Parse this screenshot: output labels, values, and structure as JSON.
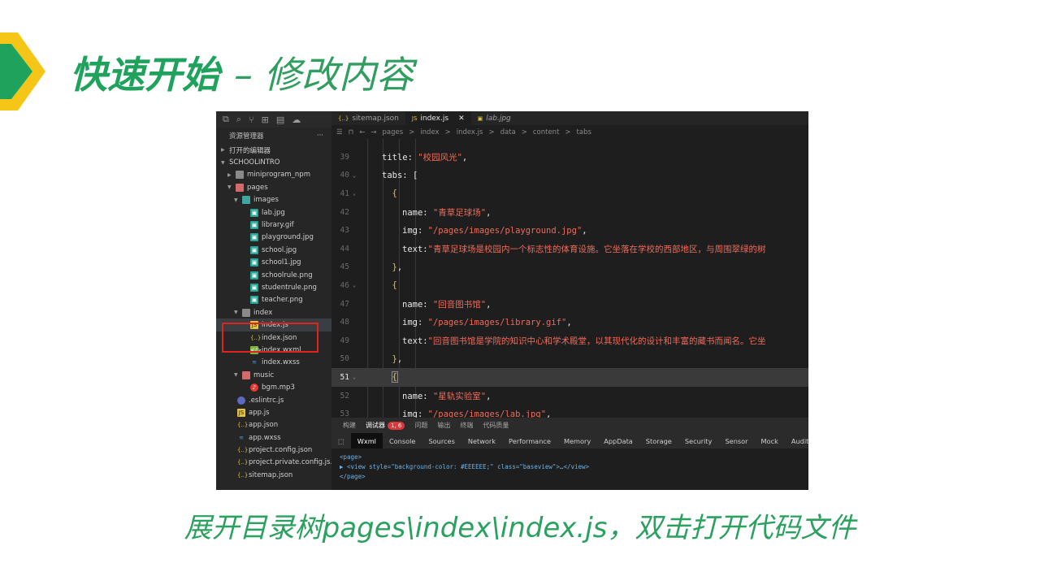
{
  "slide": {
    "title_main": "快速开始",
    "title_sep": "–",
    "title_sub": "修改内容",
    "caption": "展开目录树pages\\index\\index.js，双击打开代码文件",
    "accent_green": "#1fa35c",
    "accent_yellow": "#f5c518",
    "highlight_red": "#e0231c"
  },
  "ide": {
    "explorer_title": "资源管理器",
    "explorer_more": "···",
    "open_editors": "打开的编辑器",
    "project": "SCHOOLINTRO",
    "tree": [
      {
        "label": "miniprogram_npm",
        "depth": 1,
        "type": "folder",
        "twisty": "▶"
      },
      {
        "label": "pages",
        "depth": 1,
        "type": "fpink",
        "twisty": "▼"
      },
      {
        "label": "images",
        "depth": 2,
        "type": "fimg",
        "twisty": "▼"
      },
      {
        "label": "lab.jpg",
        "depth": 3,
        "type": "img"
      },
      {
        "label": "library.gif",
        "depth": 3,
        "type": "img"
      },
      {
        "label": "playground.jpg",
        "depth": 3,
        "type": "img"
      },
      {
        "label": "school.jpg",
        "depth": 3,
        "type": "img"
      },
      {
        "label": "school1.jpg",
        "depth": 3,
        "type": "img"
      },
      {
        "label": "schoolrule.png",
        "depth": 3,
        "type": "img"
      },
      {
        "label": "studentrule.png",
        "depth": 3,
        "type": "img"
      },
      {
        "label": "teacher.png",
        "depth": 3,
        "type": "img"
      },
      {
        "label": "index",
        "depth": 2,
        "type": "folder",
        "twisty": "▼"
      },
      {
        "label": "index.js",
        "depth": 3,
        "type": "js",
        "selected": true
      },
      {
        "label": "index.json",
        "depth": 3,
        "type": "json"
      },
      {
        "label": "index.wxml",
        "depth": 3,
        "type": "wxml"
      },
      {
        "label": "index.wxss",
        "depth": 3,
        "type": "css"
      },
      {
        "label": "music",
        "depth": 2,
        "type": "fpink",
        "twisty": "▼"
      },
      {
        "label": "bgm.mp3",
        "depth": 3,
        "type": "mp3"
      },
      {
        "label": ".eslintrc.js",
        "depth": 1,
        "type": "eslint"
      },
      {
        "label": "app.js",
        "depth": 1,
        "type": "js"
      },
      {
        "label": "app.json",
        "depth": 1,
        "type": "json"
      },
      {
        "label": "app.wxss",
        "depth": 1,
        "type": "css"
      },
      {
        "label": "project.config.json",
        "depth": 1,
        "type": "json"
      },
      {
        "label": "project.private.config.js...",
        "depth": 1,
        "type": "json"
      },
      {
        "label": "sitemap.json",
        "depth": 1,
        "type": "json"
      }
    ],
    "tabs": [
      {
        "label": "sitemap.json",
        "icon": "{..}"
      },
      {
        "label": "index.js",
        "icon": "JS",
        "active": true,
        "close": "✕"
      },
      {
        "label": "lab.jpg",
        "icon": "▣",
        "italic": true
      }
    ],
    "breadcrumb": [
      "pages",
      "index",
      "index.js",
      "data",
      "content",
      "tabs"
    ],
    "code_lines": [
      {
        "n": "39",
        "indent": 2,
        "parts": [
          [
            "k",
            "title"
          ],
          [
            "p",
            ": "
          ],
          [
            "s",
            "\"校园风光\""
          ],
          [
            "p",
            ","
          ]
        ]
      },
      {
        "n": "40",
        "indent": 2,
        "fold": true,
        "parts": [
          [
            "k",
            "tabs"
          ],
          [
            "p",
            ": ["
          ]
        ]
      },
      {
        "n": "41",
        "indent": 3,
        "fold": true,
        "parts": [
          [
            "br",
            "{"
          ]
        ]
      },
      {
        "n": "42",
        "indent": 4,
        "parts": [
          [
            "k",
            "name"
          ],
          [
            "p",
            ": "
          ],
          [
            "s",
            "\"青草足球场\""
          ],
          [
            "p",
            ","
          ]
        ]
      },
      {
        "n": "43",
        "indent": 4,
        "parts": [
          [
            "k",
            "img"
          ],
          [
            "p",
            ": "
          ],
          [
            "s",
            "\"/pages/images/playground.jpg\""
          ],
          [
            "p",
            ","
          ]
        ]
      },
      {
        "n": "44",
        "indent": 4,
        "parts": [
          [
            "k",
            "text"
          ],
          [
            "p",
            ":"
          ],
          [
            "s",
            "\"青草足球场是校园内一个标志性的体育设施。它坐落在学校的西部地区，与周围翠绿的树"
          ]
        ]
      },
      {
        "n": "45",
        "indent": 3,
        "parts": [
          [
            "br",
            "}"
          ],
          [
            "p",
            ","
          ]
        ]
      },
      {
        "n": "46",
        "indent": 3,
        "fold": true,
        "parts": [
          [
            "br",
            "{"
          ]
        ]
      },
      {
        "n": "47",
        "indent": 4,
        "parts": [
          [
            "k",
            "name"
          ],
          [
            "p",
            ": "
          ],
          [
            "s",
            "\"回音图书馆\""
          ],
          [
            "p",
            ","
          ]
        ]
      },
      {
        "n": "48",
        "indent": 4,
        "parts": [
          [
            "k",
            "img"
          ],
          [
            "p",
            ": "
          ],
          [
            "s",
            "\"/pages/images/library.gif\""
          ],
          [
            "p",
            ","
          ]
        ]
      },
      {
        "n": "49",
        "indent": 4,
        "parts": [
          [
            "k",
            "text"
          ],
          [
            "p",
            ":"
          ],
          [
            "s",
            "\"回音图书馆是学院的知识中心和学术殿堂，以其现代化的设计和丰富的藏书而闻名。它坐"
          ]
        ]
      },
      {
        "n": "50",
        "indent": 3,
        "parts": [
          [
            "br",
            "}"
          ],
          [
            "p",
            ","
          ]
        ]
      },
      {
        "n": "51",
        "indent": 3,
        "fold": true,
        "current": true,
        "parts": [
          [
            "br",
            "{"
          ]
        ]
      },
      {
        "n": "52",
        "indent": 4,
        "parts": [
          [
            "k",
            "name"
          ],
          [
            "p",
            ": "
          ],
          [
            "s",
            "\"星轨实验室\""
          ],
          [
            "p",
            ","
          ]
        ]
      },
      {
        "n": "53",
        "indent": 4,
        "parts": [
          [
            "k",
            "img"
          ],
          [
            "p",
            ": "
          ],
          [
            "s",
            "\"/pages/images/lab.jpg\""
          ],
          [
            "p",
            ","
          ]
        ]
      }
    ],
    "dev_tabs": [
      "构建",
      "调试器",
      "问题",
      "输出",
      "终端",
      "代码质量"
    ],
    "dev_badge": "1, 6",
    "panels": [
      "Wxml",
      "Console",
      "Sources",
      "Network",
      "Performance",
      "Memory",
      "AppData",
      "Storage",
      "Security",
      "Sensor",
      "Mock",
      "Audits"
    ],
    "dom_lines": [
      "<page>",
      "▶ <view style=\"background-color: #EEEEEE;\" class=\"baseview\">…</view>",
      "</page>"
    ]
  }
}
